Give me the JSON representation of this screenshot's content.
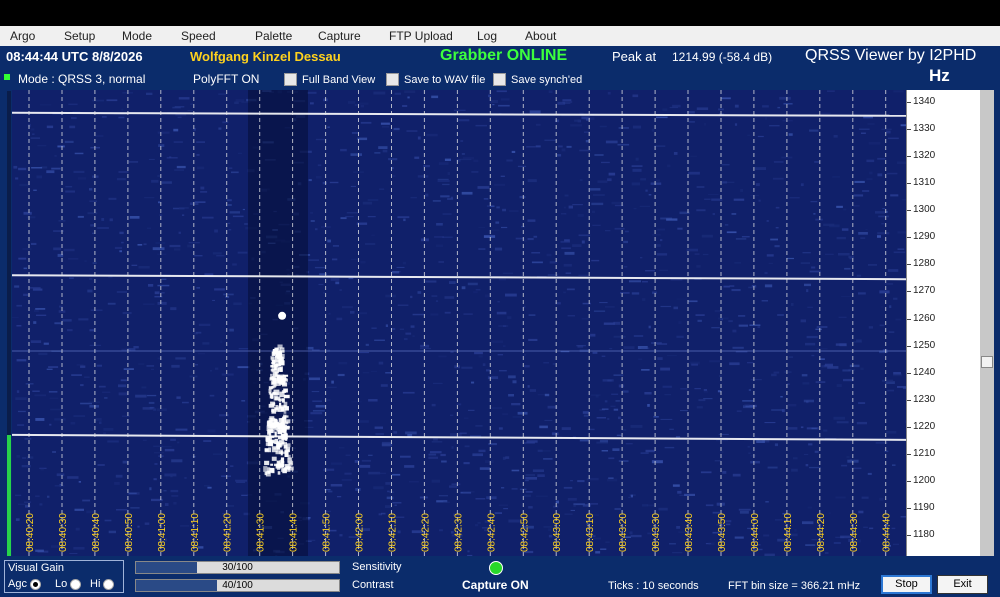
{
  "menu": {
    "items": [
      {
        "label": "Argo",
        "name": "menu-argo"
      },
      {
        "label": "Setup",
        "name": "menu-setup"
      },
      {
        "label": "Mode",
        "name": "menu-mode"
      },
      {
        "label": "Speed",
        "name": "menu-speed"
      },
      {
        "label": "Palette",
        "name": "menu-palette"
      },
      {
        "label": "Capture",
        "name": "menu-capture"
      },
      {
        "label": "FTP Upload",
        "name": "menu-ftp-upload"
      },
      {
        "label": "Log",
        "name": "menu-log"
      },
      {
        "label": "About",
        "name": "menu-about"
      }
    ]
  },
  "status": {
    "clock": "08:44:44 UTC  8/8/2026",
    "operator": "Wolfgang Kinzel Dessau",
    "grabber": "Grabber ONLINE",
    "peak_label": "Peak at",
    "peak_value": "1214.99 (-58.4 dB)",
    "app_title": "QRSS Viewer by I2PHD",
    "hz_label": "Hz"
  },
  "options": {
    "mode": "Mode : QRSS 3, normal",
    "polyfft": "PolyFFT ON",
    "full_band": "Full Band View",
    "save_wav": "Save to WAV file",
    "save_synched": "Save synch'ed"
  },
  "waterfall": {
    "time_labels": [
      "08:40:20",
      "08:40:30",
      "08:40:40",
      "08:40:50",
      "08:41:00",
      "08:41:10",
      "08:41:20",
      "08:41:30",
      "08:41:40",
      "08:41:50",
      "08:42:00",
      "08:42:10",
      "08:42:20",
      "08:42:30",
      "08:42:40",
      "08:42:50",
      "08:43:00",
      "08:43:10",
      "08:43:20",
      "08:43:30",
      "08:43:40",
      "08:43:50",
      "08:44:00",
      "08:44:10",
      "08:44:20",
      "08:44:30",
      "08:44:40"
    ],
    "freq_min": 1180,
    "freq_max": 1340,
    "freq_labels": [
      "1340",
      "1330",
      "1320",
      "1310",
      "1300",
      "1290",
      "1280",
      "1270",
      "1260",
      "1250",
      "1240",
      "1230",
      "1220",
      "1210",
      "1200",
      "1190",
      "1180"
    ],
    "carriers_hz": [
      1336,
      1276,
      1217
    ],
    "burst_center_time": "08:41:35",
    "colors": {
      "background": "#10206a",
      "signal": "#ffffff",
      "time_label": "#ffd21e"
    }
  },
  "controls": {
    "visual_gain_title": "Visual Gain",
    "agc": "Agc",
    "lo": "Lo",
    "hi": "Hi",
    "sensitivity_value": "30/100",
    "sensitivity_fraction": 0.3,
    "sensitivity_label": "Sensitivity",
    "contrast_value": "40/100",
    "contrast_fraction": 0.4,
    "contrast_label": "Contrast",
    "capture": "Capture ON",
    "ticks": "Ticks  : 10 seconds",
    "bin": "FFT bin size = 366.21 mHz",
    "stop": "Stop",
    "exit": "Exit"
  },
  "level_fraction": 0.26
}
